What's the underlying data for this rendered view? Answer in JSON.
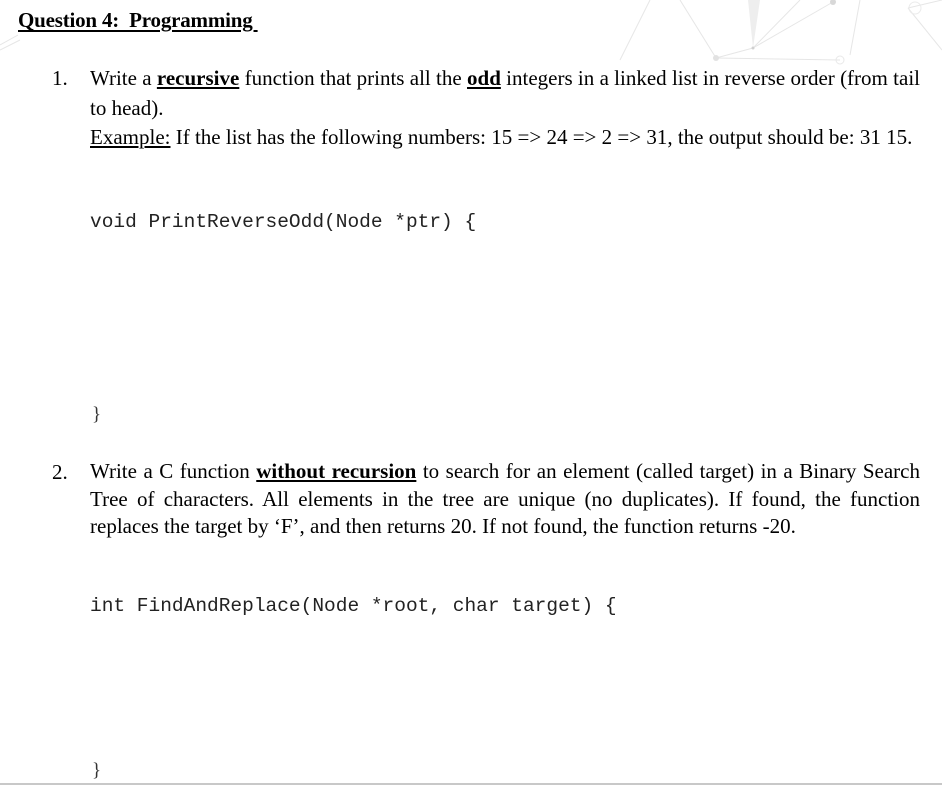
{
  "heading": "Question 4:  Programming ",
  "questions": [
    {
      "number": "1.",
      "line1_pre": "Write a ",
      "line1_bold1": "recursive",
      "line1_mid": " function that prints all the ",
      "line1_bold2": "odd",
      "line1_post": " integers in a linked list in reverse order (from tail to head).",
      "example_label": "Example:",
      "example_text": " If the list has the following numbers: 15 => 24 => 2 => 31, the output should be: 31 15.",
      "code_signature": "void PrintReverseOdd(Node *ptr) {",
      "code_close": "}"
    },
    {
      "number": "2.",
      "text_pre": "Write a C function ",
      "text_bold": "without recursion",
      "text_post": " to search for an element (called target) in a Binary Search Tree of characters. All elements in the tree are unique (no duplicates). If found, the function replaces the target by ‘F’, and then returns 20. If not found, the function returns -20.",
      "code_signature": "int FindAndReplace(Node *root, char target) {",
      "code_close": "}"
    }
  ]
}
